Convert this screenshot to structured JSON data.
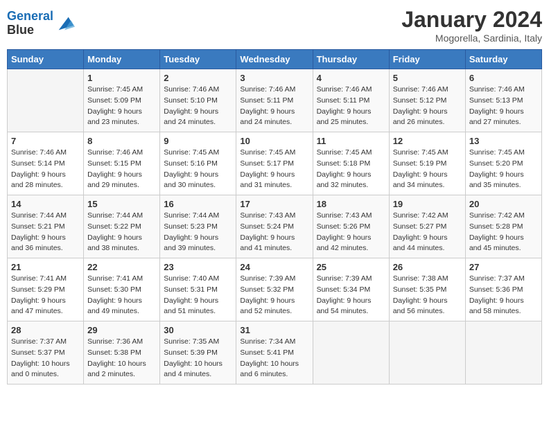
{
  "logo": {
    "line1": "General",
    "line2": "Blue"
  },
  "title": "January 2024",
  "subtitle": "Mogorella, Sardinia, Italy",
  "weekdays": [
    "Sunday",
    "Monday",
    "Tuesday",
    "Wednesday",
    "Thursday",
    "Friday",
    "Saturday"
  ],
  "weeks": [
    [
      {
        "day": "",
        "sunrise": "",
        "sunset": "",
        "daylight": ""
      },
      {
        "day": "1",
        "sunrise": "Sunrise: 7:45 AM",
        "sunset": "Sunset: 5:09 PM",
        "daylight": "Daylight: 9 hours and 23 minutes."
      },
      {
        "day": "2",
        "sunrise": "Sunrise: 7:46 AM",
        "sunset": "Sunset: 5:10 PM",
        "daylight": "Daylight: 9 hours and 24 minutes."
      },
      {
        "day": "3",
        "sunrise": "Sunrise: 7:46 AM",
        "sunset": "Sunset: 5:11 PM",
        "daylight": "Daylight: 9 hours and 24 minutes."
      },
      {
        "day": "4",
        "sunrise": "Sunrise: 7:46 AM",
        "sunset": "Sunset: 5:11 PM",
        "daylight": "Daylight: 9 hours and 25 minutes."
      },
      {
        "day": "5",
        "sunrise": "Sunrise: 7:46 AM",
        "sunset": "Sunset: 5:12 PM",
        "daylight": "Daylight: 9 hours and 26 minutes."
      },
      {
        "day": "6",
        "sunrise": "Sunrise: 7:46 AM",
        "sunset": "Sunset: 5:13 PM",
        "daylight": "Daylight: 9 hours and 27 minutes."
      }
    ],
    [
      {
        "day": "7",
        "sunrise": "Sunrise: 7:46 AM",
        "sunset": "Sunset: 5:14 PM",
        "daylight": "Daylight: 9 hours and 28 minutes."
      },
      {
        "day": "8",
        "sunrise": "Sunrise: 7:46 AM",
        "sunset": "Sunset: 5:15 PM",
        "daylight": "Daylight: 9 hours and 29 minutes."
      },
      {
        "day": "9",
        "sunrise": "Sunrise: 7:45 AM",
        "sunset": "Sunset: 5:16 PM",
        "daylight": "Daylight: 9 hours and 30 minutes."
      },
      {
        "day": "10",
        "sunrise": "Sunrise: 7:45 AM",
        "sunset": "Sunset: 5:17 PM",
        "daylight": "Daylight: 9 hours and 31 minutes."
      },
      {
        "day": "11",
        "sunrise": "Sunrise: 7:45 AM",
        "sunset": "Sunset: 5:18 PM",
        "daylight": "Daylight: 9 hours and 32 minutes."
      },
      {
        "day": "12",
        "sunrise": "Sunrise: 7:45 AM",
        "sunset": "Sunset: 5:19 PM",
        "daylight": "Daylight: 9 hours and 34 minutes."
      },
      {
        "day": "13",
        "sunrise": "Sunrise: 7:45 AM",
        "sunset": "Sunset: 5:20 PM",
        "daylight": "Daylight: 9 hours and 35 minutes."
      }
    ],
    [
      {
        "day": "14",
        "sunrise": "Sunrise: 7:44 AM",
        "sunset": "Sunset: 5:21 PM",
        "daylight": "Daylight: 9 hours and 36 minutes."
      },
      {
        "day": "15",
        "sunrise": "Sunrise: 7:44 AM",
        "sunset": "Sunset: 5:22 PM",
        "daylight": "Daylight: 9 hours and 38 minutes."
      },
      {
        "day": "16",
        "sunrise": "Sunrise: 7:44 AM",
        "sunset": "Sunset: 5:23 PM",
        "daylight": "Daylight: 9 hours and 39 minutes."
      },
      {
        "day": "17",
        "sunrise": "Sunrise: 7:43 AM",
        "sunset": "Sunset: 5:24 PM",
        "daylight": "Daylight: 9 hours and 41 minutes."
      },
      {
        "day": "18",
        "sunrise": "Sunrise: 7:43 AM",
        "sunset": "Sunset: 5:26 PM",
        "daylight": "Daylight: 9 hours and 42 minutes."
      },
      {
        "day": "19",
        "sunrise": "Sunrise: 7:42 AM",
        "sunset": "Sunset: 5:27 PM",
        "daylight": "Daylight: 9 hours and 44 minutes."
      },
      {
        "day": "20",
        "sunrise": "Sunrise: 7:42 AM",
        "sunset": "Sunset: 5:28 PM",
        "daylight": "Daylight: 9 hours and 45 minutes."
      }
    ],
    [
      {
        "day": "21",
        "sunrise": "Sunrise: 7:41 AM",
        "sunset": "Sunset: 5:29 PM",
        "daylight": "Daylight: 9 hours and 47 minutes."
      },
      {
        "day": "22",
        "sunrise": "Sunrise: 7:41 AM",
        "sunset": "Sunset: 5:30 PM",
        "daylight": "Daylight: 9 hours and 49 minutes."
      },
      {
        "day": "23",
        "sunrise": "Sunrise: 7:40 AM",
        "sunset": "Sunset: 5:31 PM",
        "daylight": "Daylight: 9 hours and 51 minutes."
      },
      {
        "day": "24",
        "sunrise": "Sunrise: 7:39 AM",
        "sunset": "Sunset: 5:32 PM",
        "daylight": "Daylight: 9 hours and 52 minutes."
      },
      {
        "day": "25",
        "sunrise": "Sunrise: 7:39 AM",
        "sunset": "Sunset: 5:34 PM",
        "daylight": "Daylight: 9 hours and 54 minutes."
      },
      {
        "day": "26",
        "sunrise": "Sunrise: 7:38 AM",
        "sunset": "Sunset: 5:35 PM",
        "daylight": "Daylight: 9 hours and 56 minutes."
      },
      {
        "day": "27",
        "sunrise": "Sunrise: 7:37 AM",
        "sunset": "Sunset: 5:36 PM",
        "daylight": "Daylight: 9 hours and 58 minutes."
      }
    ],
    [
      {
        "day": "28",
        "sunrise": "Sunrise: 7:37 AM",
        "sunset": "Sunset: 5:37 PM",
        "daylight": "Daylight: 10 hours and 0 minutes."
      },
      {
        "day": "29",
        "sunrise": "Sunrise: 7:36 AM",
        "sunset": "Sunset: 5:38 PM",
        "daylight": "Daylight: 10 hours and 2 minutes."
      },
      {
        "day": "30",
        "sunrise": "Sunrise: 7:35 AM",
        "sunset": "Sunset: 5:39 PM",
        "daylight": "Daylight: 10 hours and 4 minutes."
      },
      {
        "day": "31",
        "sunrise": "Sunrise: 7:34 AM",
        "sunset": "Sunset: 5:41 PM",
        "daylight": "Daylight: 10 hours and 6 minutes."
      },
      {
        "day": "",
        "sunrise": "",
        "sunset": "",
        "daylight": ""
      },
      {
        "day": "",
        "sunrise": "",
        "sunset": "",
        "daylight": ""
      },
      {
        "day": "",
        "sunrise": "",
        "sunset": "",
        "daylight": ""
      }
    ]
  ]
}
